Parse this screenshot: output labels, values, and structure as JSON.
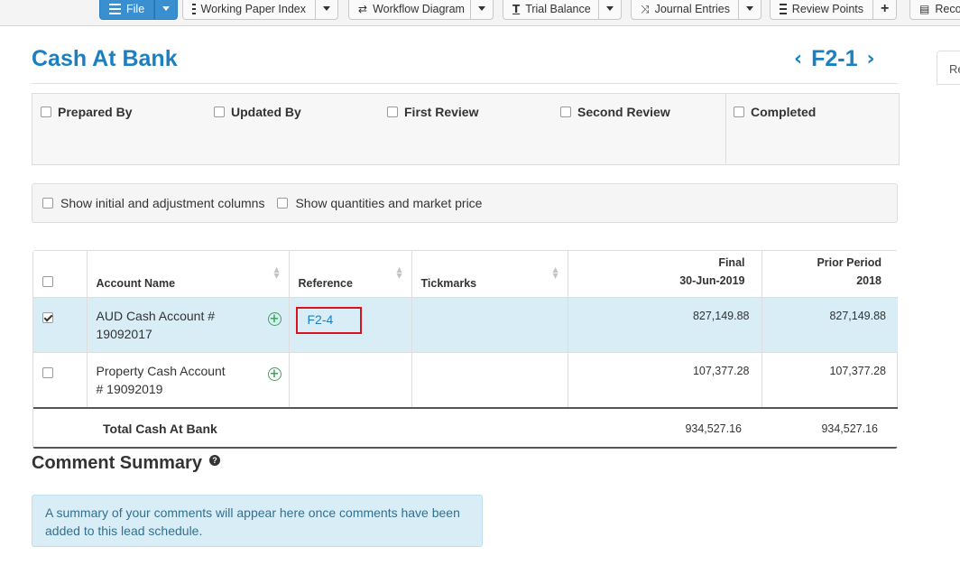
{
  "toolbar": {
    "file_label": "File",
    "working_paper_index_label": "Working Paper Index",
    "workflow_diagram_label": "Workflow Diagram",
    "trial_balance_label": "Trial Balance",
    "journal_entries_label": "Journal Entries",
    "review_points_label": "Review Points",
    "last_label": "Reco"
  },
  "header": {
    "title": "Cash At Bank",
    "ref_code": "F2-1",
    "side_tab_label": "Re"
  },
  "signoff": {
    "prepared_by": "Prepared By",
    "updated_by": "Updated By",
    "first_review": "First Review",
    "second_review": "Second Review",
    "completed": "Completed"
  },
  "options": {
    "show_initial_adjustment": "Show initial and adjustment columns",
    "show_quantities_market": "Show quantities and market price"
  },
  "table": {
    "columns": {
      "account_name": "Account Name",
      "reference": "Reference",
      "tickmarks": "Tickmarks",
      "final_line1": "Final",
      "final_line2": "30-Jun-2019",
      "prior_line1": "Prior Period",
      "prior_line2": "2018"
    },
    "rows": [
      {
        "checked": true,
        "account_name": "AUD Cash Account # 19092017",
        "reference": "F2-4",
        "tickmarks": "",
        "final": "827,149.88",
        "prior": "827,149.88"
      },
      {
        "checked": false,
        "account_name": "Property Cash Account # 19092019",
        "reference": "",
        "tickmarks": "",
        "final": "107,377.28",
        "prior": "107,377.28"
      }
    ],
    "total": {
      "label": "Total Cash At Bank",
      "final": "934,527.16",
      "prior": "934,527.16"
    }
  },
  "comments": {
    "title": "Comment Summary",
    "help_glyph": "?",
    "empty_message": "A summary of your comments will appear here once comments have been added to this lead schedule."
  },
  "colors": {
    "accent": "#1b7fc0",
    "primary_button": "#3a8fd0",
    "selected_row": "#d9edf7",
    "highlight_box": "#d9131b",
    "add_icon": "#3aa65a"
  }
}
